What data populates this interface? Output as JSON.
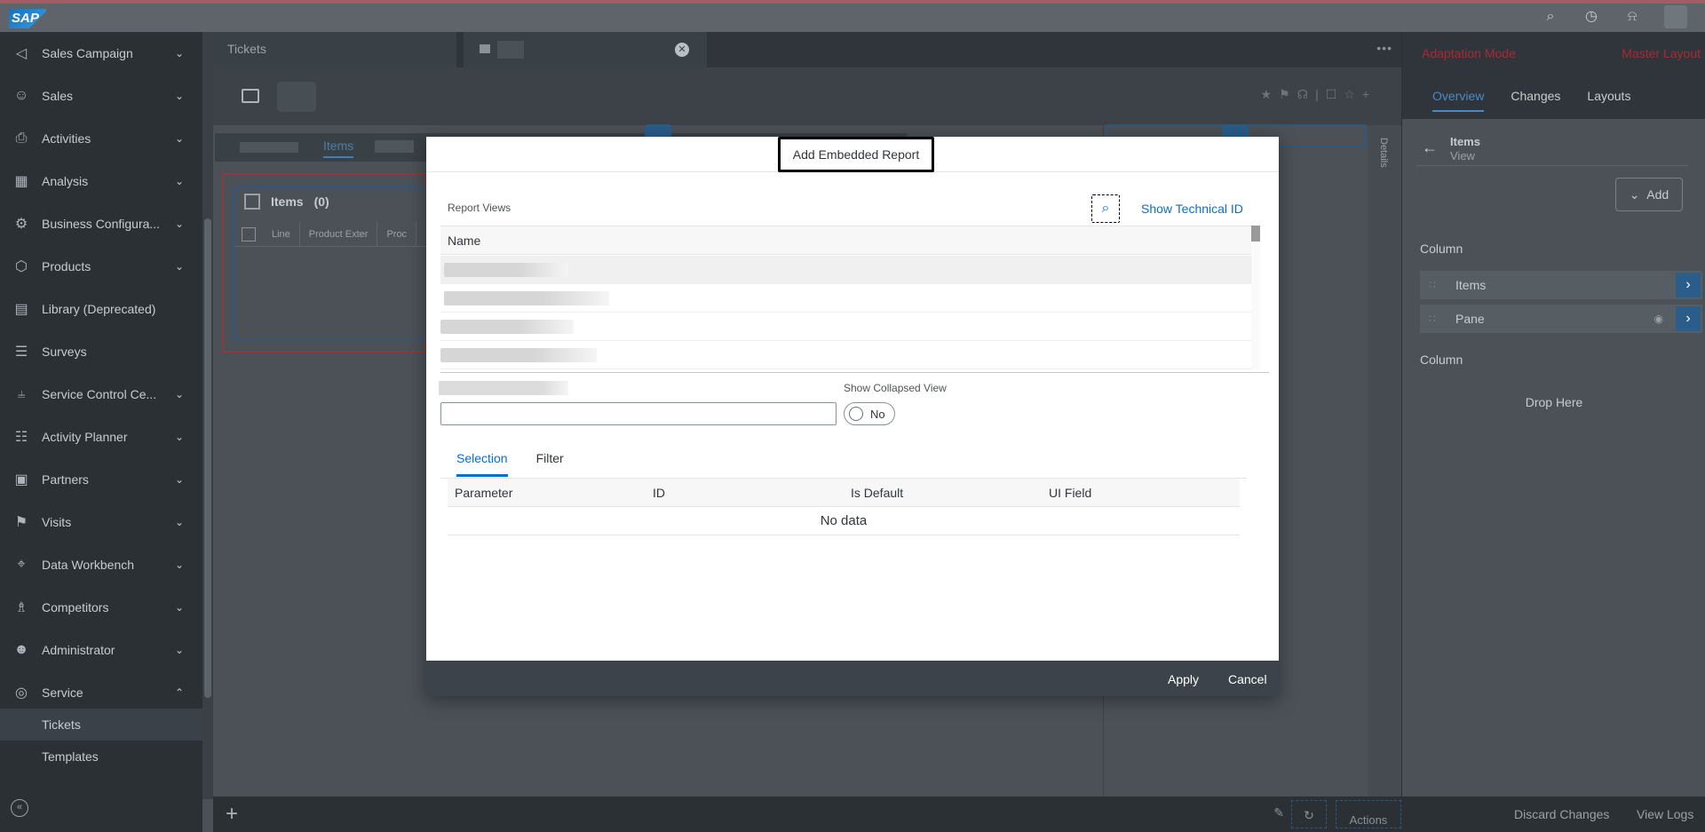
{
  "shell": {
    "logo": "SAP",
    "icons": [
      "search-icon",
      "history-icon",
      "bell-icon"
    ]
  },
  "sidebar": {
    "items": [
      {
        "label": "Sales Campaign",
        "icon": "megaphone-icon",
        "expandable": true
      },
      {
        "label": "Sales",
        "icon": "people-icon",
        "expandable": true
      },
      {
        "label": "Activities",
        "icon": "clipboard-icon",
        "expandable": true
      },
      {
        "label": "Analysis",
        "icon": "chart-icon",
        "expandable": true
      },
      {
        "label": "Business Configura...",
        "icon": "config-icon",
        "expandable": true
      },
      {
        "label": "Products",
        "icon": "product-icon",
        "expandable": true
      },
      {
        "label": "Library (Deprecated)",
        "icon": "library-icon",
        "expandable": false
      },
      {
        "label": "Surveys",
        "icon": "survey-icon",
        "expandable": false
      },
      {
        "label": "Service Control Ce...",
        "icon": "sliders-icon",
        "expandable": true
      },
      {
        "label": "Activity Planner",
        "icon": "planner-icon",
        "expandable": true
      },
      {
        "label": "Partners",
        "icon": "partner-icon",
        "expandable": true
      },
      {
        "label": "Visits",
        "icon": "visit-icon",
        "expandable": true
      },
      {
        "label": "Data Workbench",
        "icon": "workbench-icon",
        "expandable": true
      },
      {
        "label": "Competitors",
        "icon": "competitor-icon",
        "expandable": true
      },
      {
        "label": "Administrator",
        "icon": "admin-icon",
        "expandable": true
      },
      {
        "label": "Service",
        "icon": "service-icon",
        "expandable": true,
        "expanded": true
      }
    ],
    "sub_items": [
      {
        "label": "Tickets",
        "active": true
      },
      {
        "label": "Templates",
        "active": false
      }
    ]
  },
  "main": {
    "tab_label": "Tickets",
    "subtab_items": "Items",
    "items_title": "Items",
    "items_count": "(0)",
    "columns": [
      "Line",
      "Product Exter",
      "Proc"
    ],
    "details_label": "Details",
    "footer_actions": "Actions"
  },
  "adaptation": {
    "mode_label": "Adaptation Mode",
    "layout_label": "Master Layout",
    "tabs": [
      "Overview",
      "Changes",
      "Layouts"
    ],
    "active_tab": "Overview",
    "title": "Items",
    "subtitle": "View",
    "add_label": "Add",
    "column1_label": "Column",
    "column_rows": [
      {
        "label": "Items",
        "eye": false
      },
      {
        "label": "Pane",
        "eye": true
      }
    ],
    "column2_label": "Column",
    "drop_here": "Drop Here",
    "discard": "Discard Changes",
    "view_logs": "View Logs"
  },
  "dialog": {
    "title": "Add Embedded Report",
    "report_views_label": "Report Views",
    "show_technical_id": "Show Technical ID",
    "name_header": "Name",
    "show_collapsed_label": "Show Collapsed View",
    "toggle_value": "No",
    "tabs": [
      "Selection",
      "Filter"
    ],
    "active_tab": "Selection",
    "param_headers": [
      "Parameter",
      "ID",
      "Is Default",
      "UI Field"
    ],
    "no_data": "No data",
    "apply": "Apply",
    "cancel": "Cancel"
  }
}
